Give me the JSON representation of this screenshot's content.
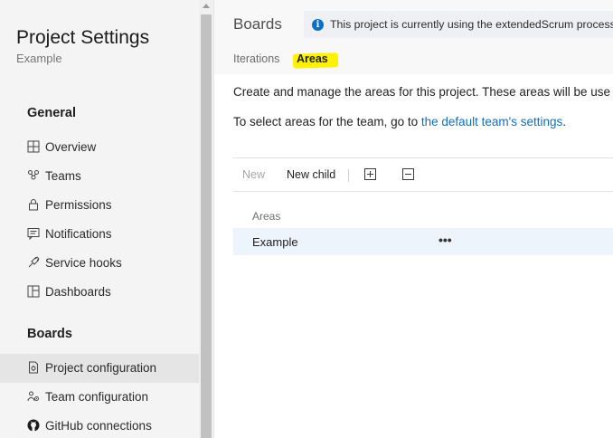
{
  "sidebar": {
    "project_title": "Project Settings",
    "project_name": "Example",
    "sections": {
      "general": "General",
      "boards": "Boards"
    },
    "general_items": [
      {
        "label": "Overview",
        "icon": "overview-icon"
      },
      {
        "label": "Teams",
        "icon": "teams-icon"
      },
      {
        "label": "Permissions",
        "icon": "lock-icon"
      },
      {
        "label": "Notifications",
        "icon": "notification-icon"
      },
      {
        "label": "Service hooks",
        "icon": "service-hooks-icon"
      },
      {
        "label": "Dashboards",
        "icon": "dashboards-icon"
      }
    ],
    "boards_items": [
      {
        "label": "Project configuration",
        "icon": "project-config-icon",
        "selected": true
      },
      {
        "label": "Team configuration",
        "icon": "team-config-icon"
      },
      {
        "label": "GitHub connections",
        "icon": "github-icon"
      }
    ]
  },
  "header": {
    "title": "Boards",
    "banner": "This project is currently using the extendedScrum process. T"
  },
  "tabs": [
    {
      "label": "Iterations",
      "active": false
    },
    {
      "label": "Areas",
      "active": true
    }
  ],
  "content": {
    "description": "Create and manage the areas for this project. These areas will be use",
    "team_text": "To select areas for the team, go to ",
    "team_link": "the default team's settings",
    "team_text_end": "."
  },
  "toolbar": {
    "new_label": "New",
    "new_child_label": "New child",
    "expand_icon": "expand-all-icon",
    "collapse_icon": "collapse-all-icon"
  },
  "grid": {
    "column_header": "Areas",
    "rows": [
      {
        "label": "Example",
        "more": "•••"
      }
    ]
  },
  "colors": {
    "accent": "#106ebe",
    "highlight": "#fff200",
    "info_icon": "#0b6fc9"
  }
}
